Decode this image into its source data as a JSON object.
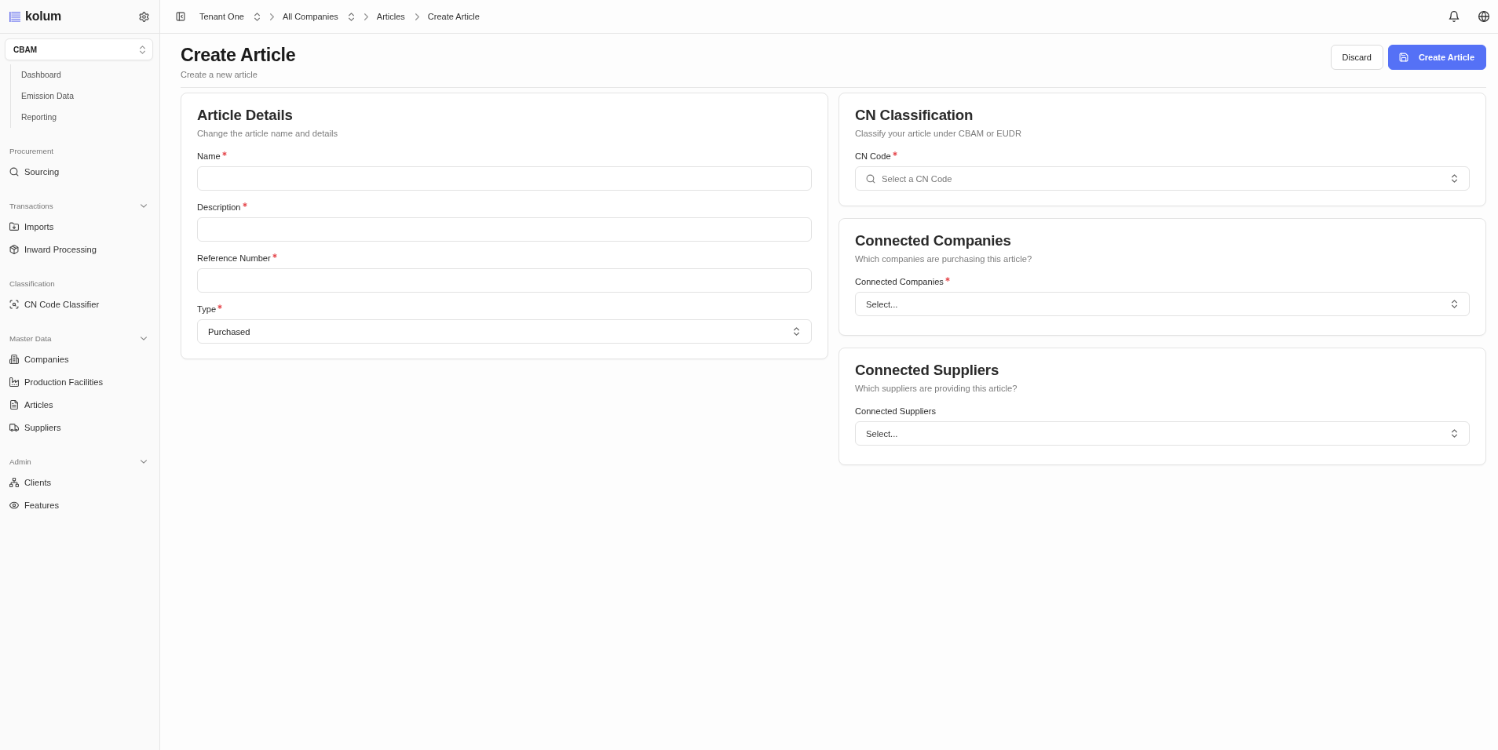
{
  "sidebar": {
    "brand": "kolum",
    "module_selector": {
      "value": "CBAM"
    },
    "module_items": [
      {
        "label": "Dashboard"
      },
      {
        "label": "Emission Data"
      },
      {
        "label": "Reporting"
      }
    ],
    "sections": [
      {
        "title": "Procurement",
        "collapsible": false,
        "items": [
          {
            "label": "Sourcing"
          }
        ]
      },
      {
        "title": "Transactions",
        "collapsible": true,
        "items": [
          {
            "label": "Imports"
          },
          {
            "label": "Inward Processing"
          }
        ]
      },
      {
        "title": "Classification",
        "collapsible": false,
        "items": [
          {
            "label": "CN Code Classifier"
          }
        ]
      },
      {
        "title": "Master Data",
        "collapsible": true,
        "items": [
          {
            "label": "Companies"
          },
          {
            "label": "Production Facilities"
          },
          {
            "label": "Articles"
          },
          {
            "label": "Suppliers"
          }
        ]
      },
      {
        "title": "Admin",
        "collapsible": true,
        "items": [
          {
            "label": "Clients"
          },
          {
            "label": "Features"
          }
        ]
      }
    ]
  },
  "topbar": {
    "breadcrumbs": [
      {
        "label": "Tenant One",
        "kind": "switcher"
      },
      {
        "label": "All Companies",
        "kind": "switcher"
      },
      {
        "label": "Articles",
        "kind": "link"
      },
      {
        "label": "Create Article",
        "kind": "current"
      }
    ]
  },
  "header": {
    "title": "Create Article",
    "subtitle": "Create a new article",
    "buttons": [
      {
        "label": "Discard",
        "kind": "outline"
      },
      {
        "label": "Create Article",
        "kind": "primary"
      }
    ]
  },
  "left_cards": [
    {
      "title": "Article Details",
      "subtitle": "Change the article name and details",
      "fields": [
        {
          "label": "Name",
          "required": true,
          "kind": "text"
        },
        {
          "label": "Description",
          "required": true,
          "kind": "text"
        },
        {
          "label": "Reference Number",
          "required": true,
          "kind": "text"
        },
        {
          "label": "Type",
          "required": true,
          "kind": "select",
          "value": "Purchased"
        }
      ]
    }
  ],
  "right_cards": [
    {
      "title": "CN Classification",
      "subtitle": "Classify your article under CBAM or EUDR",
      "fields": [
        {
          "label": "CN Code",
          "required": true,
          "kind": "search-select",
          "placeholder": "Select a CN Code"
        }
      ]
    },
    {
      "title": "Connected Companies",
      "subtitle": "Which companies are purchasing this article?",
      "fields": [
        {
          "label": "Connected Companies",
          "required": true,
          "kind": "select",
          "placeholder": "Select..."
        }
      ]
    },
    {
      "title": "Connected Suppliers",
      "subtitle": "Which suppliers are providing this article?",
      "fields": [
        {
          "label": "Connected Suppliers",
          "required": false,
          "kind": "select",
          "placeholder": "Select..."
        }
      ]
    }
  ]
}
